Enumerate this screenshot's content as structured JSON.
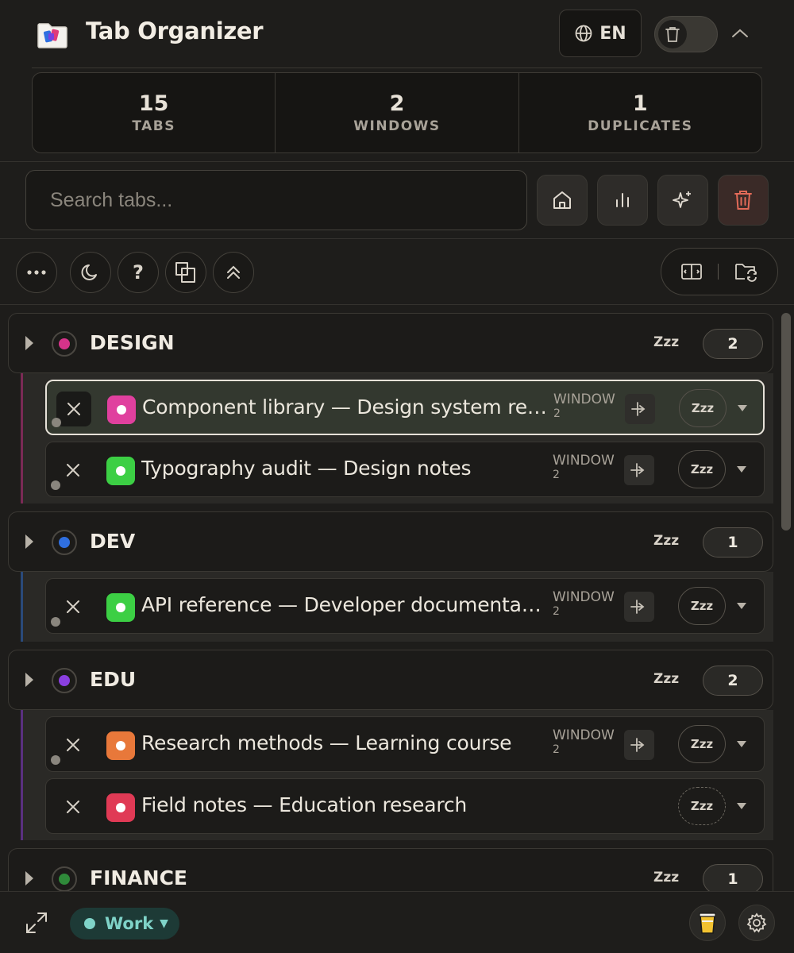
{
  "header": {
    "title": "Tab Organizer",
    "language": "EN"
  },
  "stats": [
    {
      "value": "15",
      "label": "TABS"
    },
    {
      "value": "2",
      "label": "WINDOWS"
    },
    {
      "value": "1",
      "label": "DUPLICATES"
    }
  ],
  "search": {
    "placeholder": "Search tabs...",
    "value": ""
  },
  "toolbar": {
    "help_label": "?"
  },
  "groups": [
    {
      "name": "DESIGN",
      "color": "#d6338a",
      "sleep_label": "Zzz",
      "count": "2",
      "tabs": [
        {
          "title": "Component library — Design system review",
          "favicon_color": "#e0409e",
          "window_label": "WINDOW",
          "window_num": "2",
          "sleep_label": "Zzz",
          "active": true
        },
        {
          "title": "Typography audit — Design notes",
          "favicon_color": "#3ccf44",
          "window_label": "WINDOW",
          "window_num": "2",
          "sleep_label": "Zzz"
        }
      ]
    },
    {
      "name": "DEV",
      "color": "#2f6fe0",
      "sleep_label": "Zzz",
      "count": "1",
      "tabs": [
        {
          "title": "API reference — Developer documentation",
          "favicon_color": "#3ccf44",
          "window_label": "WINDOW",
          "window_num": "2",
          "sleep_label": "Zzz"
        }
      ]
    },
    {
      "name": "EDU",
      "color": "#8a3fe0",
      "sleep_label": "Zzz",
      "count": "2",
      "tabs": [
        {
          "title": "Research methods — Learning course",
          "favicon_color": "#e8783a",
          "window_label": "WINDOW",
          "window_num": "2",
          "sleep_label": "Zzz"
        },
        {
          "title": "Field notes — Education research",
          "favicon_color": "#e03a55",
          "sleep_label": "Zzz"
        }
      ]
    },
    {
      "name": "FINANCE",
      "color": "#2f8a3a",
      "sleep_label": "Zzz",
      "count": "1",
      "tabs": []
    }
  ],
  "footer": {
    "workspace": "Work",
    "workspace_color": "#7fd3c8"
  }
}
